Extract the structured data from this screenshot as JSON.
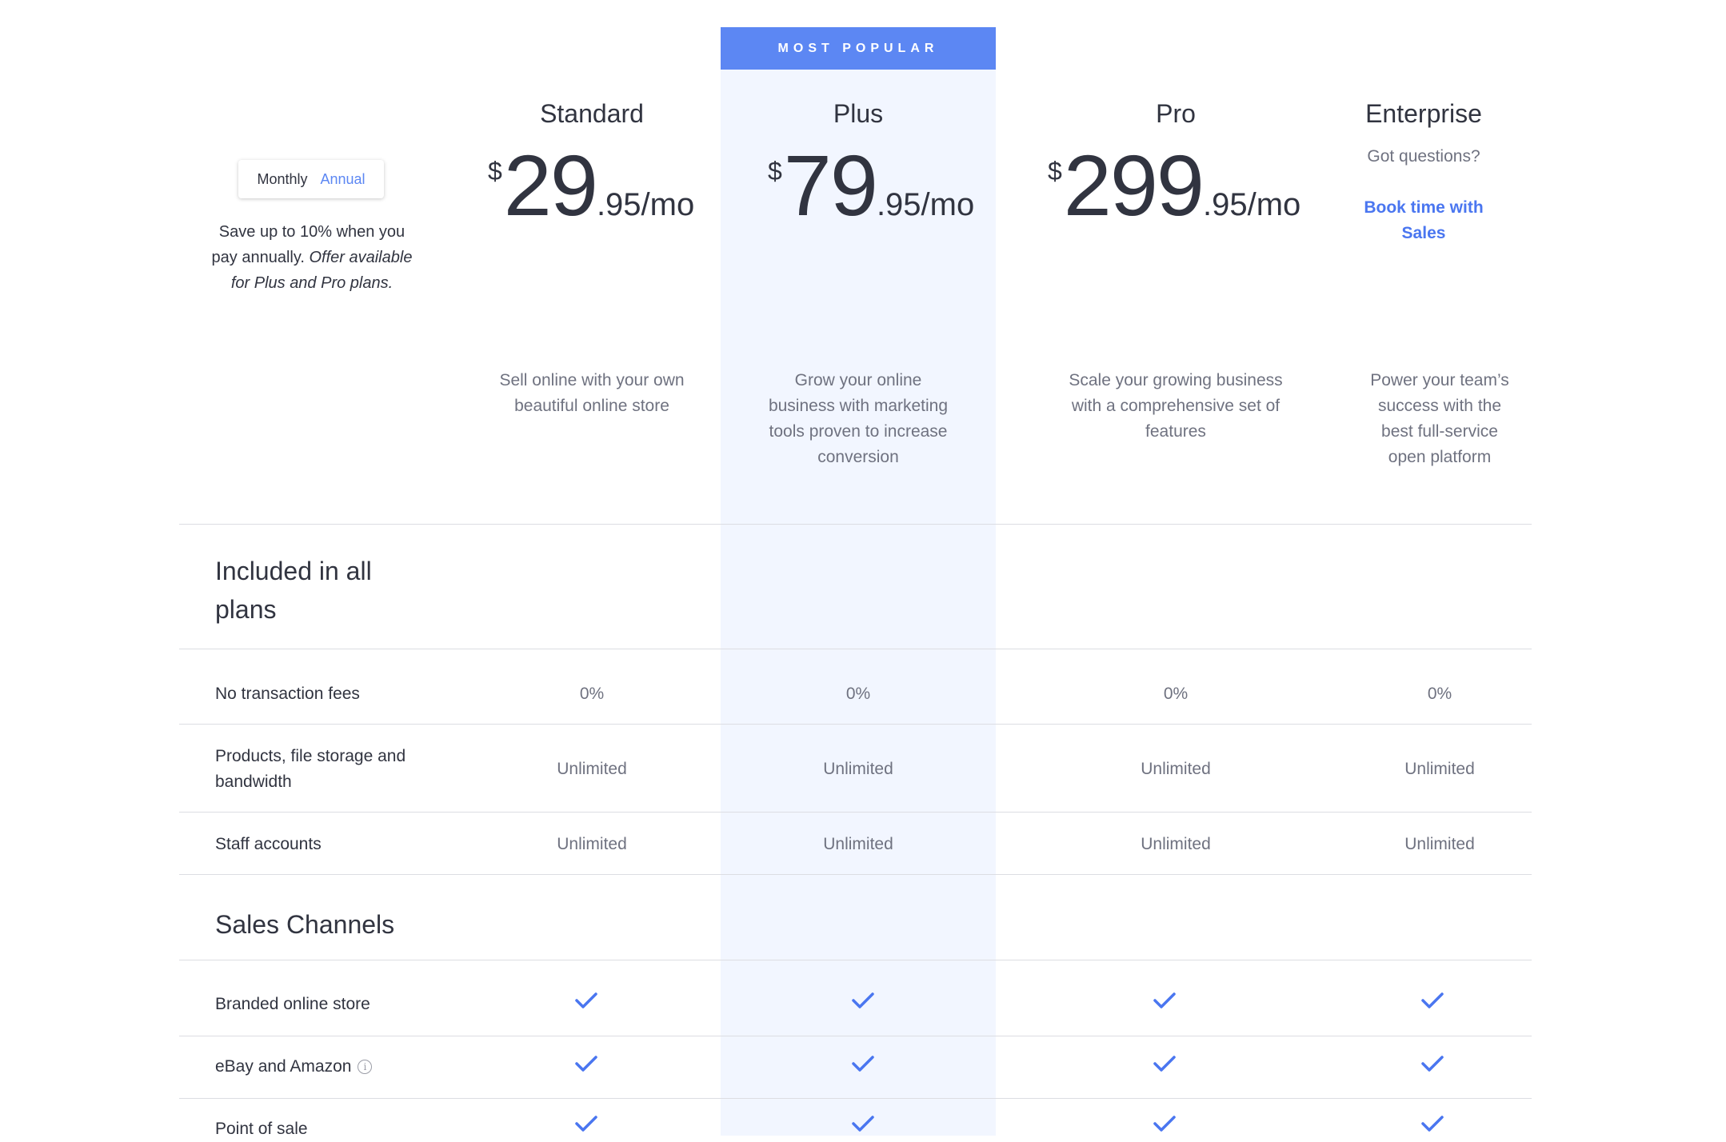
{
  "badge": "MOST POPULAR",
  "billing_toggle": {
    "monthly": "Monthly",
    "annual": "Annual"
  },
  "save_note": {
    "text": "Save up to 10% when you pay annually.",
    "italic": "Offer available for Plus and Pro plans."
  },
  "plans": [
    {
      "name": "Standard",
      "currency": "$",
      "price": "29",
      "cents": ".95/mo",
      "description": "Sell online with your own beautiful online store"
    },
    {
      "name": "Plus",
      "currency": "$",
      "price": "79",
      "cents": ".95/mo",
      "description": "Grow your online business with marketing tools proven to increase conversion"
    },
    {
      "name": "Pro",
      "currency": "$",
      "price": "299",
      "cents": ".95/mo",
      "description": "Scale your growing business with a comprehensive set of features"
    },
    {
      "name": "Enterprise",
      "question": "Got questions?",
      "cta": "Book time with Sales",
      "description": "Power your team’s success with the best full-service open platform"
    }
  ],
  "sections": [
    {
      "title": "Included in all plans",
      "rows": [
        {
          "label": "No transaction fees",
          "values": [
            "0%",
            "0%",
            "0%",
            "0%"
          ]
        },
        {
          "label": "Products, file storage and bandwidth",
          "values": [
            "Unlimited",
            "Unlimited",
            "Unlimited",
            "Unlimited"
          ]
        },
        {
          "label": "Staff accounts",
          "values": [
            "Unlimited",
            "Unlimited",
            "Unlimited",
            "Unlimited"
          ]
        }
      ]
    },
    {
      "title": "Sales Channels",
      "rows": [
        {
          "label": "Branded online store",
          "checks": [
            true,
            true,
            true,
            true
          ]
        },
        {
          "label": "eBay and Amazon",
          "info_icon": "info-circle-icon",
          "checks": [
            true,
            true,
            true,
            true
          ]
        },
        {
          "label": "Point of sale",
          "checks": [
            true,
            true,
            true,
            true
          ]
        }
      ]
    }
  ],
  "colors": {
    "accent": "#5c87f3",
    "highlight_column": "#f2f6ff",
    "link": "#4a76f0",
    "check": "#4a76f0"
  }
}
